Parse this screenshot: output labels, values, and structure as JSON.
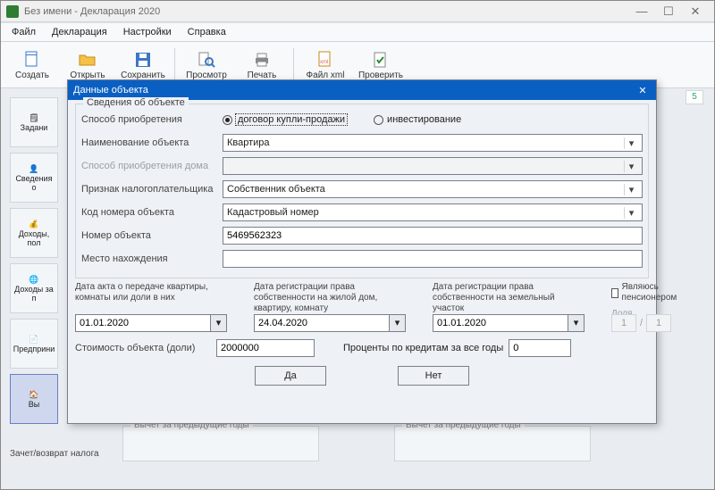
{
  "window": {
    "title": "Без имени - Декларация 2020"
  },
  "menu": {
    "file": "Файл",
    "decl": "Декларация",
    "settings": "Настройки",
    "help": "Справка"
  },
  "toolbar": {
    "create": "Создать",
    "open": "Открыть",
    "save": "Сохранить",
    "preview": "Просмотр",
    "print": "Печать",
    "xml": "Файл xml",
    "check": "Проверить"
  },
  "nav": {
    "tasks": "Задани",
    "person": "Сведения о",
    "income": "Доходы, пол",
    "income2": "Доходы за п",
    "entr": "Предприни",
    "deduct": "Вы",
    "bottom_label": "Зачет/возврат налога"
  },
  "bg": {
    "vyc1": "Вычет за предыдущие годы",
    "vyc2": "Вычет за предыдущие годы",
    "page": "5"
  },
  "modal": {
    "title": "Данные объекта",
    "group_label": "Сведения об объекте",
    "method_label": "Способ приобретения",
    "radio_contract": "договор купли-продажи",
    "radio_invest": "инвестирование",
    "name_label": "Наименование объекта",
    "name_value": "Квартира",
    "house_method_label": "Способ приобретения дома",
    "taxpayer_attr_label": "Признак налогоплательщика",
    "taxpayer_attr_value": "Собственник объекта",
    "code_label": "Код номера объекта",
    "code_value": "Кадастровый номер",
    "num_label": "Номер объекта",
    "num_value": "5469562323",
    "loc_label": "Место нахождения",
    "loc_value": "",
    "date_act_label": "Дата акта о передаче квартиры, комнаты или доли в них",
    "date_reg_house_label": "Дата регистрации права собственности на жилой дом, квартиру, комнату",
    "date_reg_land_label": "Дата регистрации права собственности на земельный участок",
    "pensioner_label": "Являюсь пенсионером",
    "share_label": "Доля",
    "date_act": "01.01.2020",
    "date_reg_house": "24.04.2020",
    "date_reg_land": "01.01.2020",
    "share_num": "1",
    "share_den": "1",
    "cost_label": "Стоимость объекта (доли)",
    "cost_value": "2000000",
    "interest_label": "Проценты по кредитам за все годы",
    "interest_value": "0",
    "btn_yes": "Да",
    "btn_no": "Нет"
  }
}
